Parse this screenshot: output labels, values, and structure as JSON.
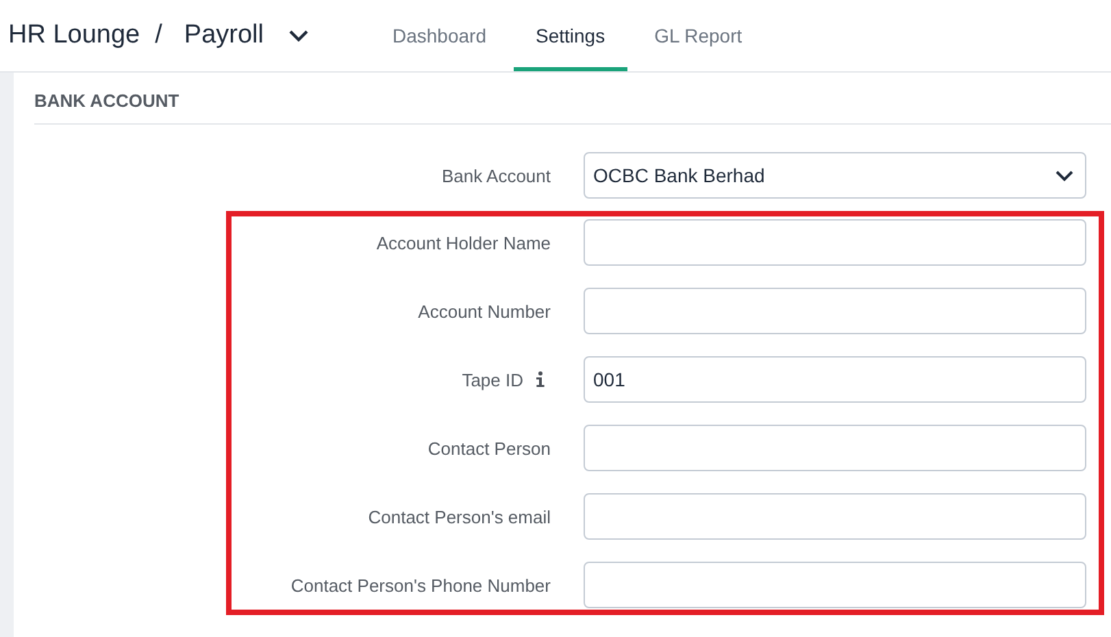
{
  "header": {
    "app": "HR Lounge",
    "separator": "/",
    "module": "Payroll"
  },
  "tabs": [
    {
      "label": "Dashboard",
      "selected": false
    },
    {
      "label": "Settings",
      "selected": true
    },
    {
      "label": "GL Report",
      "selected": false
    }
  ],
  "section": {
    "title": "BANK ACCOUNT"
  },
  "bank_field": {
    "label": "Bank Account",
    "kind": "select",
    "value": "OCBC Bank Berhad"
  },
  "highlighted_fields": [
    {
      "label": "Account Holder Name",
      "kind": "text",
      "info": false
    },
    {
      "label": "Account Number",
      "kind": "text",
      "info": false
    },
    {
      "label": "Tape ID",
      "kind": "text",
      "info": true,
      "value": "001"
    },
    {
      "label": "Contact Person",
      "kind": "text",
      "info": false
    },
    {
      "label": "Contact Person's email",
      "kind": "text",
      "info": false
    },
    {
      "label": "Contact Person's Phone Number",
      "kind": "text",
      "info": false
    }
  ]
}
